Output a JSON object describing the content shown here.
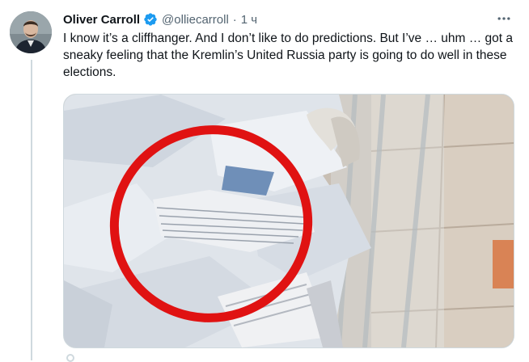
{
  "tweet": {
    "author_name": "Oliver Carroll",
    "handle": "@olliecarroll",
    "separator": "·",
    "time": "1 ч",
    "text": "I know it’s a cliffhanger. And I don’t like to do predictions. But I’ve … uhm … got a sneaky feeling that the Kremlin’s United Russia party is going to do well in these elections.",
    "verified": true,
    "more_icon": "more-horizontal-icon",
    "verified_icon": "verified-badge-icon"
  },
  "colors": {
    "text": "#0f1419",
    "secondary": "#536471",
    "verified": "#1d9bf0",
    "highlight_circle": "#e01212"
  }
}
